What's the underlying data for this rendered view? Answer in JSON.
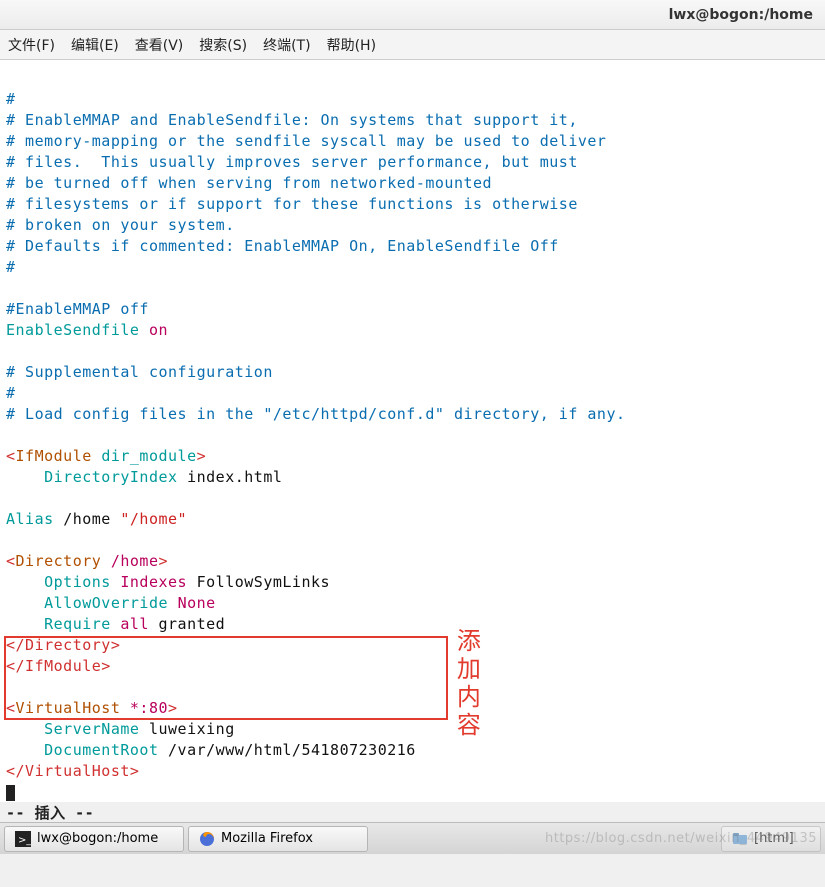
{
  "titlebar": {
    "text": "lwx@bogon:/home"
  },
  "menubar": {
    "items": [
      "文件(F)",
      "编辑(E)",
      "查看(V)",
      "搜索(S)",
      "终端(T)",
      "帮助(H)"
    ]
  },
  "editor": {
    "comment_lines": [
      "#",
      "# EnableMMAP and EnableSendfile: On systems that support it,",
      "# memory-mapping or the sendfile syscall may be used to deliver",
      "# files.  This usually improves server performance, but must",
      "# be turned off when serving from networked-mounted",
      "# filesystems or if support for these functions is otherwise",
      "# broken on your system.",
      "# Defaults if commented: EnableMMAP On, EnableSendfile Off",
      "#"
    ],
    "enablemmap_line": "#EnableMMAP off",
    "enable_sendfile": {
      "directive": "EnableSendfile",
      "value": "on"
    },
    "supplemental": [
      "# Supplemental configuration",
      "#",
      "# Load config files in the \"/etc/httpd/conf.d\" directory, if any."
    ],
    "ifmodule_open": {
      "lt": "<",
      "tag": "IfModule",
      "arg": "dir_module",
      "gt": ">"
    },
    "dirindex": {
      "directive": "DirectoryIndex",
      "value": "index.html"
    },
    "alias": {
      "directive": "Alias",
      "path": "/home",
      "quoted": "\"/home\""
    },
    "directory_open": {
      "lt": "<",
      "tag": "Directory",
      "arg": "/home",
      "gt": ">"
    },
    "options": {
      "directive": "Options",
      "w1": "Indexes",
      "w2": "FollowSymLinks"
    },
    "allowoverride": {
      "directive": "AllowOverride",
      "value": "None"
    },
    "require": {
      "directive": "Require",
      "w1": "all",
      "w2": "granted"
    },
    "directory_close": "</Directory>",
    "ifmodule_close": "</IfModule>",
    "vhost_open": {
      "lt": "<",
      "tag": "VirtualHost",
      "arg": "*:",
      "port": "80",
      "gt": ">"
    },
    "servername": {
      "directive": "ServerName",
      "value": "luweixing"
    },
    "docroot": {
      "directive": "DocumentRoot",
      "value": "/var/www/html/541807230216"
    },
    "vhost_close": "</VirtualHost>",
    "mode": "-- 插入 --"
  },
  "annotation": {
    "text": "添加内容"
  },
  "taskbar": {
    "task1": {
      "label": "lwx@bogon:/home"
    },
    "task2": {
      "label": "Mozilla Firefox"
    },
    "task3": {
      "label": "[html]"
    }
  },
  "watermark": "https://blog.csdn.net/weixin_44949135"
}
